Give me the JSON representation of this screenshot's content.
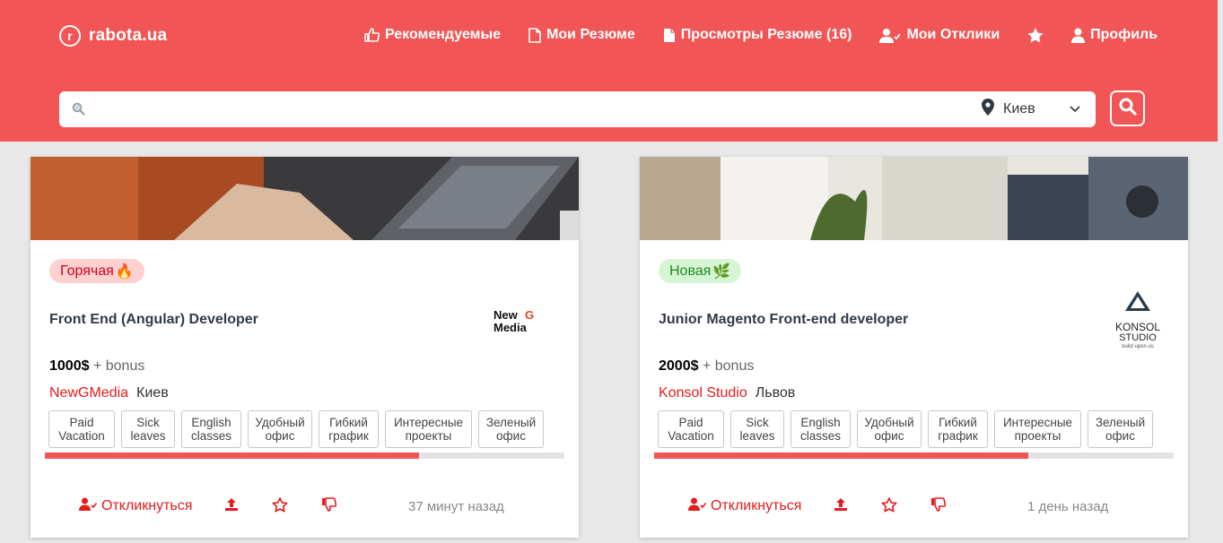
{
  "header": {
    "logo_mark": "r",
    "logo_text": "rabota.ua",
    "nav": [
      {
        "label": "Рекомендуемые",
        "icon": "thumbs-up-icon"
      },
      {
        "label": "Мои Резюме",
        "icon": "document-icon"
      },
      {
        "label": "Просмотры Резюме (16)",
        "icon": "document-filled-icon"
      },
      {
        "label": "Мои Отклики",
        "icon": "user-check-icon"
      },
      {
        "label": "",
        "icon": "star-icon"
      },
      {
        "label": "Профиль",
        "icon": "user-icon"
      }
    ],
    "search": {
      "placeholder": "",
      "value": "",
      "location": "Киев"
    }
  },
  "colors": {
    "brand": "#f25555",
    "link": "#e41b1b",
    "hot_bg": "#ffd0d0",
    "new_bg": "#d5f5d5"
  },
  "cards": [
    {
      "badge": "Горячая",
      "badge_emoji": "🔥",
      "title": "Front End (Angular) Developer",
      "salary": "1000$",
      "bonus": "+ bonus",
      "company": "NewGMedia",
      "city": "Киев",
      "logo": {
        "line1a": "New",
        "line1b": "G",
        "line2": "Media"
      },
      "tags": [
        "Paid Vacation",
        "Sick leaves",
        "English classes",
        "Удобный офис",
        "Гибкий график",
        "Интересные проекты",
        "Зеленый офис"
      ],
      "match_progress": 0.72,
      "respond_label": "Откликнуться",
      "time_ago": "37 минут назад"
    },
    {
      "badge": "Новая",
      "badge_emoji": "🌿",
      "title": "Junior Magento Front-end developer",
      "salary": "2000$",
      "bonus": "+ bonus",
      "company": "Konsol Studio",
      "city": "Львов",
      "logo": {
        "line1": "KONSOL",
        "line2": "STUDIO",
        "line3": "build upon us"
      },
      "tags": [
        "Paid Vacation",
        "Sick leaves",
        "English classes",
        "Удобный офис",
        "Гибкий график",
        "Интересные проекты",
        "Зеленый офис"
      ],
      "match_progress": 0.72,
      "respond_label": "Откликнуться",
      "time_ago": "1 день назад"
    }
  ]
}
